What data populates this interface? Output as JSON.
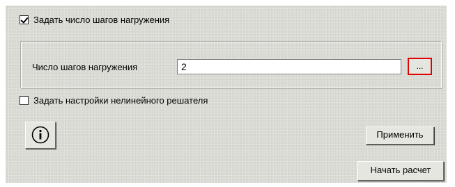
{
  "window": {
    "load_steps_checkbox": {
      "label": "Задать число шагов нагружения",
      "checked": true
    },
    "load_steps_group": {
      "field_label": "Число шагов нагружения",
      "field_value": "2",
      "browse_button_label": "..."
    },
    "nonlinear_solver_checkbox": {
      "label": "Задать настройки нелинейного решателя",
      "checked": false
    },
    "info_button": {
      "icon": "info-icon"
    },
    "apply_button_label": "Применить",
    "start_button_label": "Начать расчет",
    "colors": {
      "panel_background": "#dcdcd6",
      "highlight_border": "#e10000"
    }
  }
}
